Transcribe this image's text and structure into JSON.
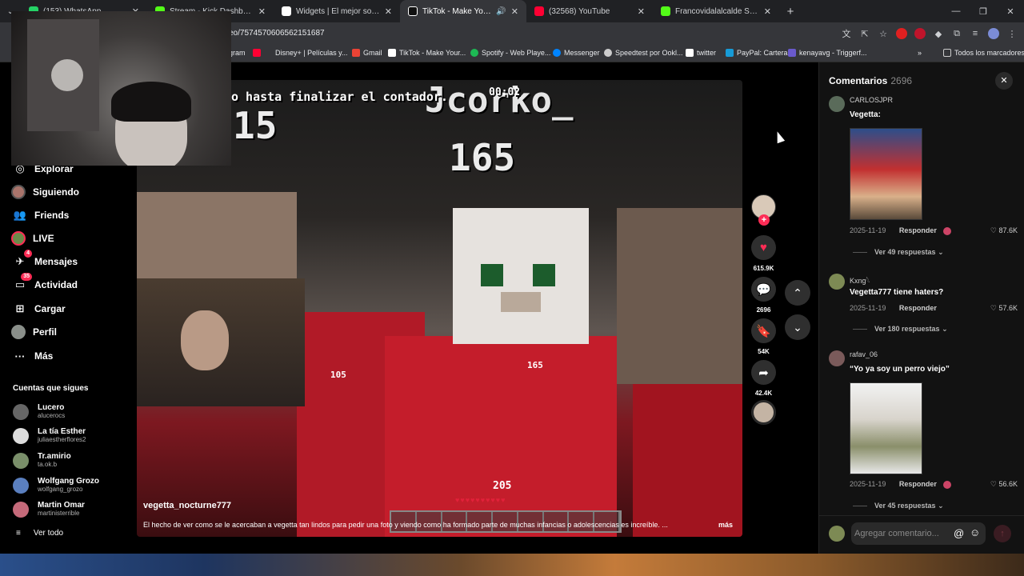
{
  "browser": {
    "tabs": [
      {
        "title": "(153) WhatsApp",
        "color": "#25d366",
        "active": false
      },
      {
        "title": "Stream - Kick Dashboard",
        "color": "#53fc18",
        "active": false
      },
      {
        "title": "Widgets | El mejor software pa",
        "color": "#ffffff",
        "active": false
      },
      {
        "title": "TikTok - Make Your Day",
        "color": "#ffffff",
        "active": true
      },
      {
        "title": "(32568) YouTube",
        "color": "#ff0033",
        "active": false
      },
      {
        "title": "Francovidalalcalde Stream - Wa",
        "color": "#53fc18",
        "active": false
      }
    ],
    "url": "eo/7574570606562151687",
    "bookmarks": [
      {
        "label": "gram",
        "color": "#c13584"
      },
      {
        "label": "Disney+ | Películas y...",
        "color": "#113ccf"
      },
      {
        "label": "Gmail",
        "color": "#ea4335"
      },
      {
        "label": "TikTok - Make Your...",
        "color": "#ffffff"
      },
      {
        "label": "Spotify - Web Playe...",
        "color": "#1db954"
      },
      {
        "label": "Messenger",
        "color": "#0084ff"
      },
      {
        "label": "Speedtest por Ookl...",
        "color": "#cccccc"
      },
      {
        "label": "twitter",
        "color": "#ffffff"
      },
      {
        "label": "PayPal: Cartera",
        "color": "#179bd7"
      },
      {
        "label": "kenayavg - Triggerf...",
        "color": "#6a5acd"
      }
    ],
    "all_bookmarks": "Todos los marcadores"
  },
  "sidebar": {
    "nav": [
      {
        "label": "Explorar",
        "icon": "compass-icon"
      },
      {
        "label": "Siguiendo",
        "icon": "following-icon"
      },
      {
        "label": "Friends",
        "icon": "friends-icon"
      },
      {
        "label": "LIVE",
        "icon": "live-icon"
      },
      {
        "label": "Mensajes",
        "icon": "messages-icon",
        "badge": "4"
      },
      {
        "label": "Actividad",
        "icon": "activity-icon",
        "badge": "35"
      },
      {
        "label": "Cargar",
        "icon": "upload-icon"
      },
      {
        "label": "Perfil",
        "icon": "profile-icon"
      },
      {
        "label": "Más",
        "icon": "more-icon"
      }
    ],
    "following_title": "Cuentas que sigues",
    "following": [
      {
        "name": "Lucero",
        "handle": "alucerocs",
        "color": "#666666"
      },
      {
        "name": "La tía Esther",
        "handle": "juliaestherflores2",
        "color": "#dddddd"
      },
      {
        "name": "Tr.amirio",
        "handle": "ta.ok.b",
        "color": "#7a8f6a"
      },
      {
        "name": "Wolfgang Grozo",
        "handle": "wolfgang_grozo",
        "color": "#5a7fbf"
      },
      {
        "name": "Martin Omar",
        "handle": "martinisterrible",
        "color": "#c56a7a"
      }
    ],
    "see_all": "Ver todo"
  },
  "video": {
    "overlay_message": "o hasta finalizar el contador.",
    "timer": "00:02",
    "overlay_name": "Jcorko_",
    "big_number": "165",
    "left_number": "15",
    "tag1": "105",
    "tag2": "165",
    "hp": "205",
    "username": "vegetta_nocturne777",
    "description": "El hecho de ver como se le acercaban a vegetta tan lindos para pedir una foto y viendo como ha formado parte de muchas infancias o adolescencias es increíble. ...",
    "more": "más"
  },
  "actions": {
    "likes": "615.9K",
    "comments": "2696",
    "saves": "54K",
    "shares": "42.4K"
  },
  "comments_panel": {
    "title": "Comentarios",
    "count": "2696",
    "comments": [
      {
        "user": "CARLOSJPR",
        "text": "Vegetta:",
        "date": "2025-11-19",
        "reply": "Responder",
        "likes": "87.6K",
        "more": "Ver 49 respuestas",
        "color": "#5a6b5a"
      },
      {
        "user": "Kxng𓆩",
        "text": "Vegetta777 tiene haters?",
        "date": "2025-11-19",
        "reply": "Responder",
        "likes": "57.6K",
        "more": "Ver 180 respuestas",
        "color": "#7d8a54"
      },
      {
        "user": "rafav_06",
        "text": "“Yo ya soy un perro viejo”",
        "date": "2025-11-19",
        "reply": "Responder",
        "likes": "56.6K",
        "more": "Ver 45 respuestas",
        "color": "#7a5a5a"
      }
    ],
    "placeholder": "Agregar comentario..."
  }
}
